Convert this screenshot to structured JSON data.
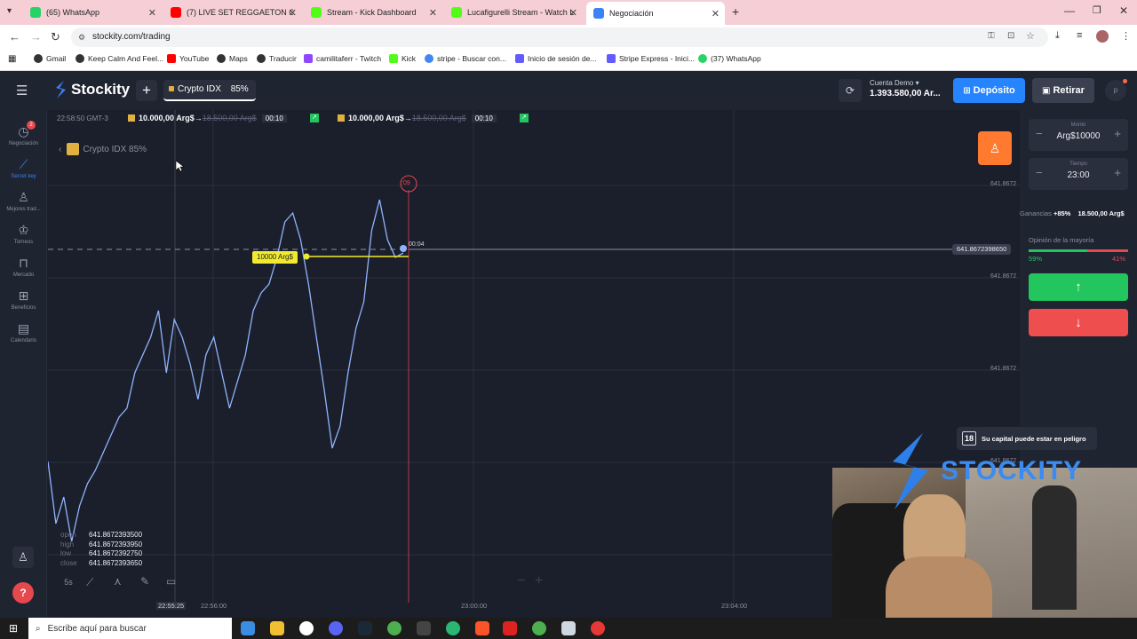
{
  "browser": {
    "tabs": [
      {
        "label": "(65) WhatsApp",
        "color": "#25d366"
      },
      {
        "label": "(7) LIVE SET REGGAETON O",
        "color": "#ff0000"
      },
      {
        "label": "Stream - Kick Dashboard",
        "color": "#53fc18"
      },
      {
        "label": "Lucafigurelli Stream - Watch Li",
        "color": "#53fc18"
      },
      {
        "label": "Negociación",
        "color": "#3b82f6"
      }
    ],
    "url": "stockity.com/trading",
    "bookmarks": [
      "Gmail",
      "Keep Calm And Feel...",
      "YouTube",
      "Maps",
      "Traducir",
      "camilitaferr - Twitch",
      "Kick",
      "stripe - Buscar con...",
      "Inicio de sesión de...",
      "Stripe Express - Inici...",
      "(37) WhatsApp"
    ]
  },
  "app": {
    "brand": "Stockity",
    "asset_tab": {
      "name": "Crypto IDX",
      "payout": "85%"
    },
    "account": {
      "label": "Cuenta Demo",
      "balance": "1.393.580,00 Ar..."
    },
    "deposit_label": "Depósito",
    "withdraw_label": "Retirar",
    "avatar_letter": "p"
  },
  "sidebar": {
    "items": [
      {
        "label": "Negociación",
        "icon": "clock-icon",
        "badge": "2"
      },
      {
        "label": "Secret key",
        "icon": "chart-icon",
        "active": true
      },
      {
        "label": "Mejores trad...",
        "icon": "user-icon"
      },
      {
        "label": "Torneos",
        "icon": "trophy-icon"
      },
      {
        "label": "Mercado",
        "icon": "bag-icon"
      },
      {
        "label": "Beneficios",
        "icon": "gift-icon"
      },
      {
        "label": "Calendario",
        "icon": "calendar-icon"
      }
    ]
  },
  "chart": {
    "time": "22:58:50 GMT-3",
    "trades": [
      {
        "amount": "10.000,00 Arg$",
        "payout": "18.500,00 Arg$",
        "timer": "00:10"
      },
      {
        "amount": "10.000,00 Arg$",
        "payout": "18.500,00 Arg$",
        "timer": "00:10"
      }
    ],
    "asset_label": "Crypto IDX 85%",
    "price_levels": [
      "641.8672",
      "641.8672",
      "641.8672",
      "641.8672"
    ],
    "current_price": "641.8672398650",
    "trade_marker": "10000 Arg$",
    "countdown": ":09",
    "marker_timer": "00:04",
    "ohlc": [
      {
        "k": "open",
        "v": "641.8672393500"
      },
      {
        "k": "high",
        "v": "641.8672393950"
      },
      {
        "k": "low",
        "v": "641.8672392750"
      },
      {
        "k": "close",
        "v": "641.8672393650"
      }
    ],
    "timeframe": "5s",
    "x_ticks": [
      "22:55:25",
      "22:56:00",
      "23:00:00",
      "23:04:00"
    ],
    "line_y": [
      520,
      590,
      560,
      610,
      570,
      545,
      530,
      510,
      490,
      470,
      460,
      420,
      400,
      380,
      350,
      420,
      360,
      380,
      410,
      450,
      400,
      380,
      420,
      460,
      430,
      400,
      350,
      330,
      320,
      290,
      250,
      240,
      270,
      320,
      380,
      440,
      505,
      480,
      420,
      370,
      340,
      260,
      225,
      270,
      290,
      285
    ]
  },
  "panel": {
    "amount_label": "Monto",
    "amount_value": "Arg$10000",
    "time_label": "Tiempo",
    "time_value": "23:00",
    "earnings_label": "Ganancias",
    "earnings_pct": "+85%",
    "earnings_value": "18.500,00 Arg$",
    "opinion_label": "Opinión de la mayoría",
    "up_pct": "59%",
    "down_pct": "41%",
    "up_fraction": 0.59
  },
  "overlay": {
    "age_badge": "18",
    "warning": "Su capital puede estar en peligro",
    "logo_text": "STOCKITY"
  },
  "taskbar": {
    "search_placeholder": "Escribe aquí para buscar"
  }
}
